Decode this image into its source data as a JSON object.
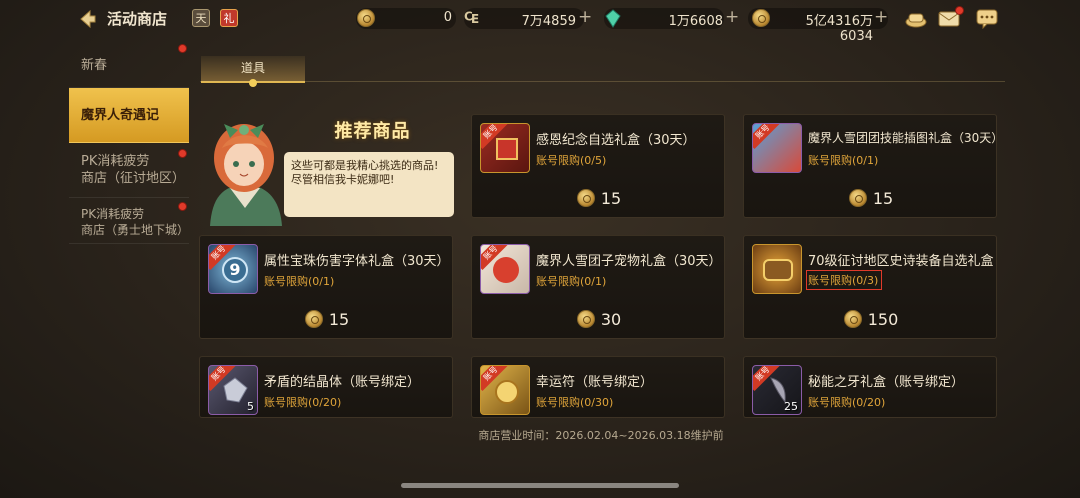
{
  "header": {
    "title": "活动商店",
    "currencies": [
      {
        "icon": "gold-coin-icon",
        "value": "0"
      },
      {
        "icon": "c-currency-icon",
        "value": "7万4859"
      },
      {
        "icon": "green-crystal-icon",
        "value": "1万6608"
      },
      {
        "icon": "gold-bag-icon",
        "value": "5亿4316万6034"
      }
    ],
    "icons": [
      "back-arrow-icon",
      "calendar-icon",
      "gift-bag-icon",
      "treasure-icon",
      "mail-icon",
      "chat-icon"
    ]
  },
  "sidebar": {
    "items": [
      {
        "label": "新春",
        "active": false,
        "dot": true
      },
      {
        "label": "魔界人奇遇记",
        "active": true,
        "dot": false
      },
      {
        "label_line1": "PK消耗疲劳",
        "label_line2": "商店（征讨地区）",
        "active": false,
        "dot": true
      },
      {
        "label_line1": "PK消耗疲劳",
        "label_line2": "商店（勇士地下城）",
        "active": false,
        "dot": true
      }
    ]
  },
  "tabs": [
    {
      "label": "道具",
      "active": true
    }
  ],
  "recommend": {
    "title": "推荐商品",
    "speech": "这些可都是我精心挑选的商品!\n尽管相信我卡妮娜吧!"
  },
  "products": [
    {
      "name": "感恩纪念自选礼盒（30天）",
      "limit": "账号限购(0/5)",
      "price": "15",
      "badge": "账号",
      "thumb": "gift-box-icon",
      "qty": ""
    },
    {
      "name": "魔界人雪团团技能插图礼盒（30天）",
      "limit": "账号限购(0/1)",
      "price": "15",
      "badge": "账号",
      "thumb": "illustration-box-icon",
      "qty": ""
    },
    {
      "name": "属性宝珠伤害字体礼盒（30天）",
      "limit": "账号限购(0/1)",
      "price": "15",
      "badge": "账号",
      "thumb": "orb-font-icon",
      "qty": ""
    },
    {
      "name": "魔界人雪团子宠物礼盒（30天）",
      "limit": "账号限购(0/1)",
      "price": "30",
      "badge": "账号",
      "thumb": "pet-box-icon",
      "qty": ""
    },
    {
      "name": "70级征讨地区史诗装备自选礼盒",
      "limit": "账号限购(0/3)",
      "price": "150",
      "badge": "",
      "thumb": "epic-box-icon",
      "qty": ""
    },
    {
      "name": "矛盾的结晶体（账号绑定）",
      "limit": "账号限购(0/20)",
      "price": "",
      "badge": "账号",
      "thumb": "crystal-icon",
      "qty": "5"
    },
    {
      "name": "幸运符（账号绑定）",
      "limit": "账号限购(0/30)",
      "price": "",
      "badge": "账号",
      "thumb": "lucky-charm-icon",
      "qty": ""
    },
    {
      "name": "秘能之牙礼盒（账号绑定）",
      "limit": "账号限购(0/20)",
      "price": "",
      "badge": "账号",
      "thumb": "fang-box-icon",
      "qty": "25"
    }
  ],
  "footer": {
    "text": "商店营业时间：2026.02.04~2026.03.18维护前"
  }
}
